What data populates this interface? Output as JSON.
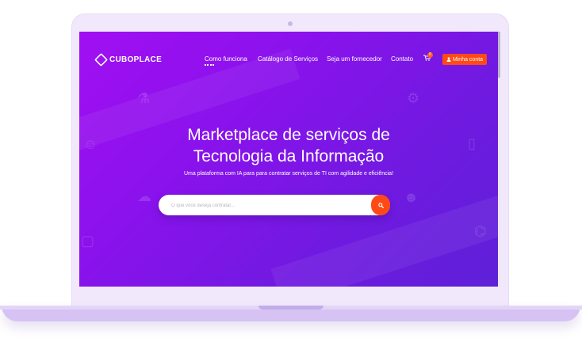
{
  "brand": {
    "name": "CUBOPLACE"
  },
  "nav": {
    "items": [
      {
        "label": "Como funciona"
      },
      {
        "label": "Catálogo de Serviços"
      },
      {
        "label": "Seja um fornecedor"
      },
      {
        "label": "Contato"
      }
    ],
    "cart_count": "0",
    "account_label": "Minha conta"
  },
  "hero": {
    "title_line1": "Marketplace de serviços de",
    "title_line2": "Tecnologia da Informação",
    "subtitle": "Uma plataforma com IA para para contratar serviços de TI com agilidade e eficiência!"
  },
  "search": {
    "placeholder": "O que você deseja contratar..."
  },
  "colors": {
    "accent": "#ff4a16",
    "hero_start": "#a10ff2",
    "hero_end": "#5e20d8",
    "device": "#f1e9fb"
  },
  "icons": {
    "search": "search-icon",
    "cart": "cart-icon",
    "user": "user-icon",
    "logo": "cube-logo-icon"
  }
}
